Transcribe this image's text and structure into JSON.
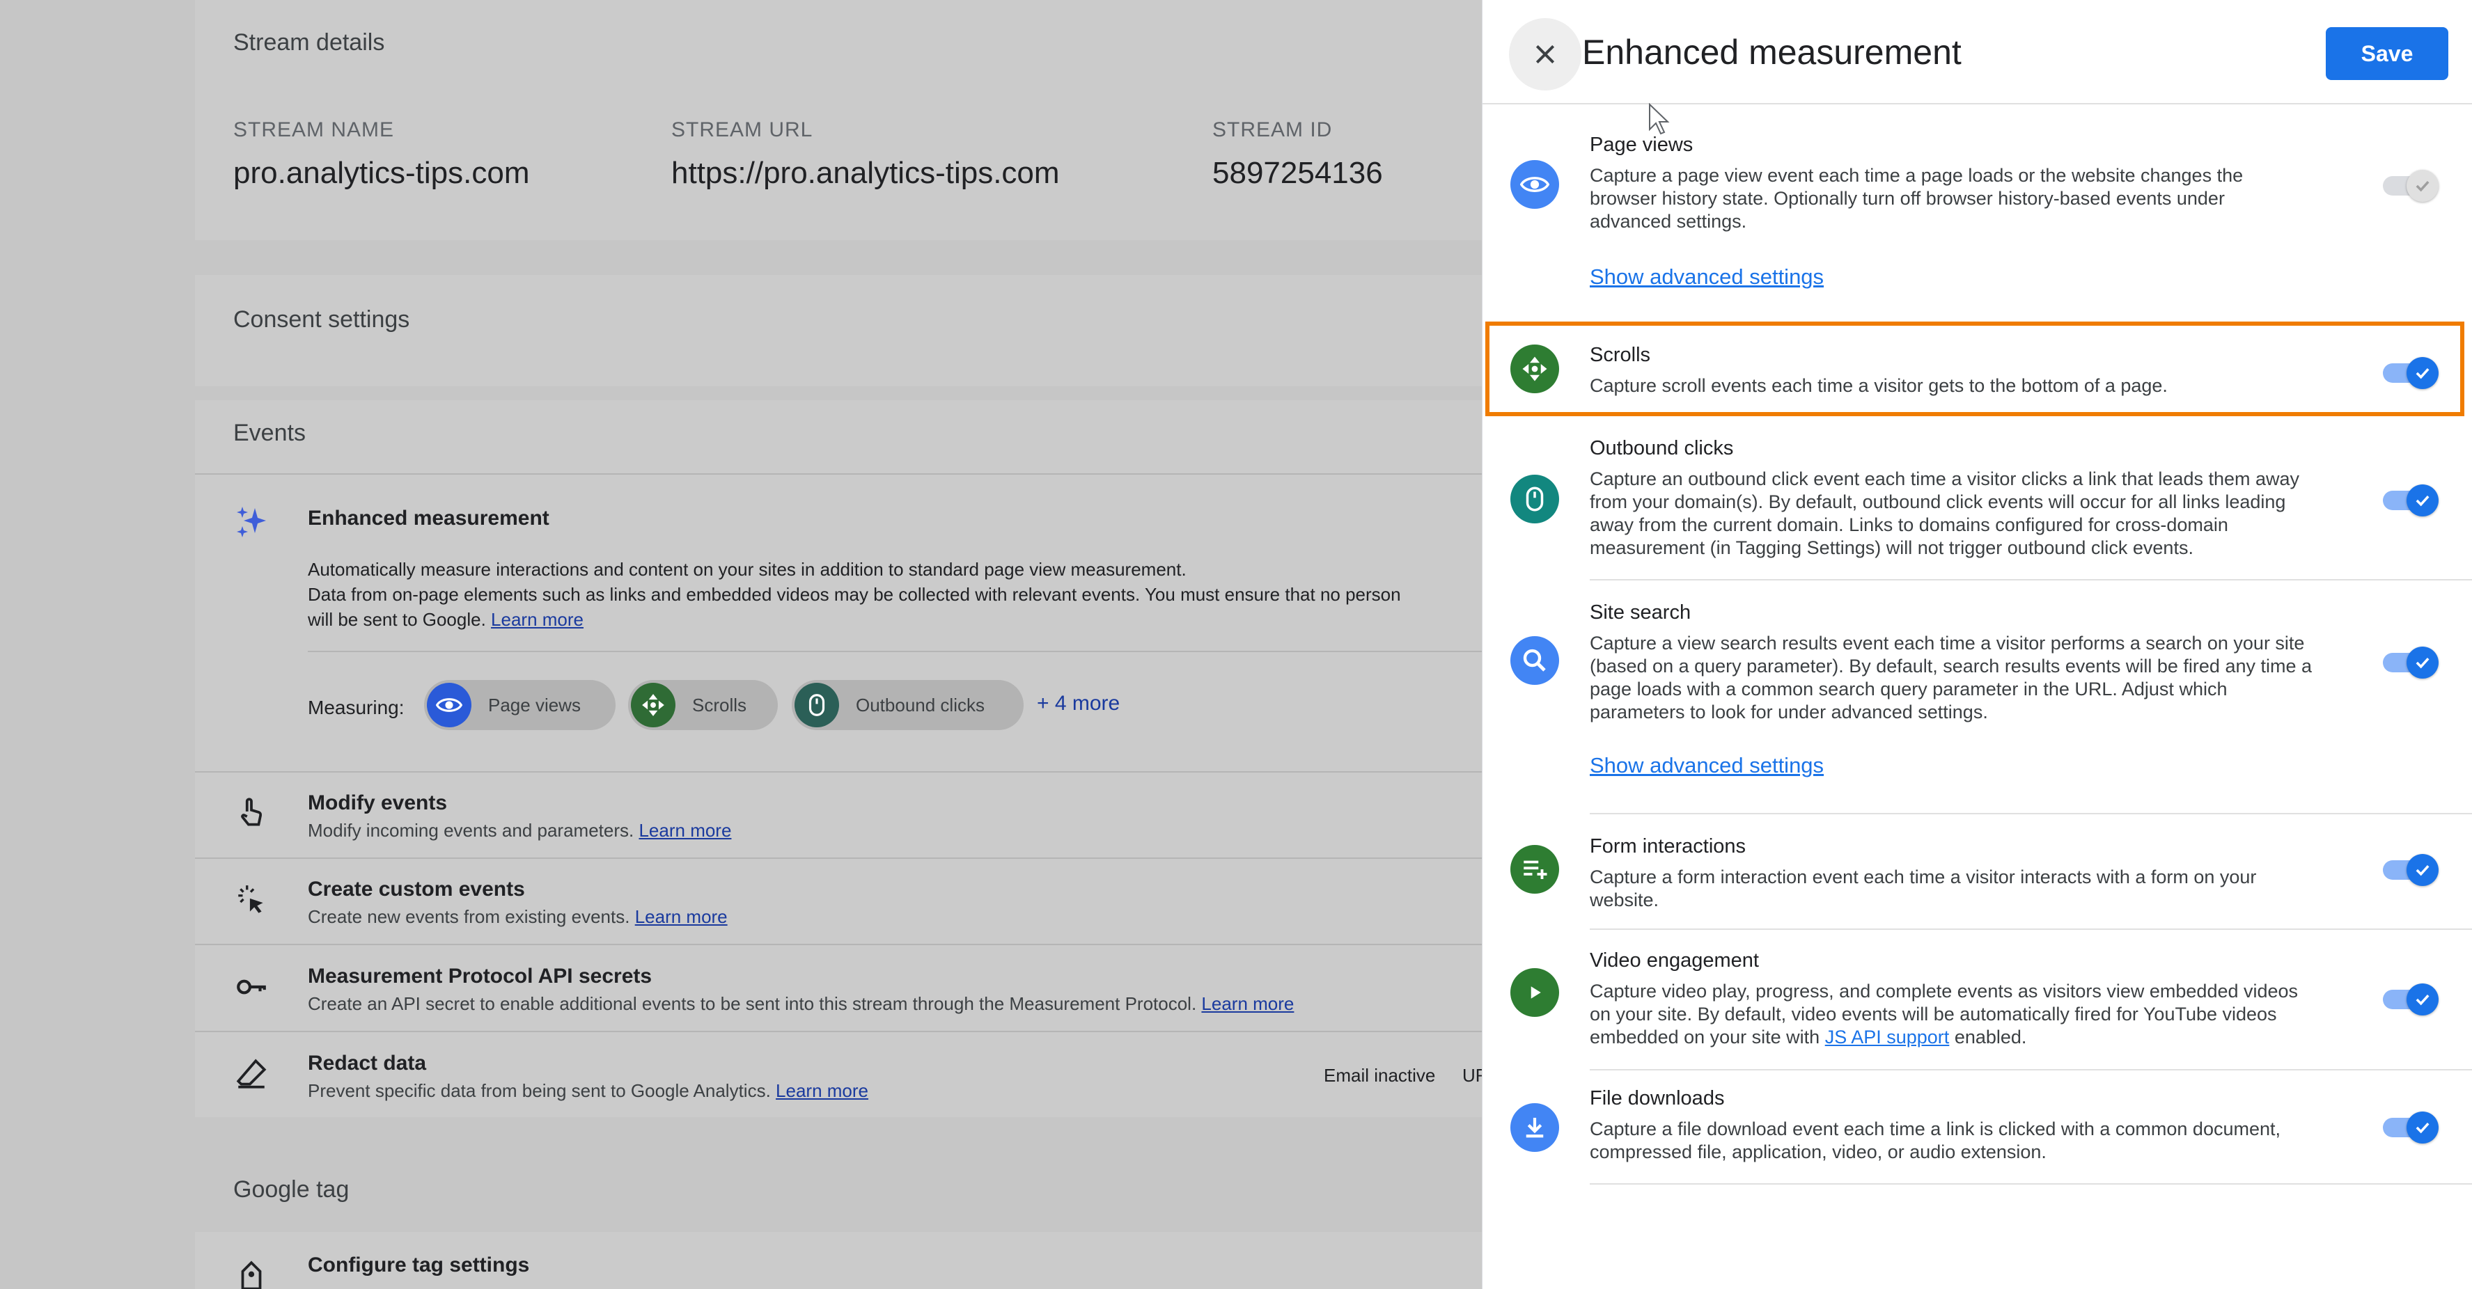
{
  "background": {
    "stream_details": {
      "title": "Stream details",
      "name_label": "STREAM NAME",
      "name_value": "pro.analytics-tips.com",
      "url_label": "STREAM URL",
      "url_value": "https://pro.analytics-tips.com",
      "id_label": "STREAM ID",
      "id_value": "5897254136"
    },
    "consent_title": "Consent settings",
    "events_title": "Events",
    "enhanced": {
      "title": "Enhanced measurement",
      "desc_line1": "Automatically measure interactions and content on your sites in addition to standard page view measurement.",
      "desc_line2": "Data from on-page elements such as links and embedded videos may be collected with relevant events. You must ensure that no person",
      "desc_line3": "will be sent to Google.",
      "learn_more": "Learn more",
      "measuring_label": "Measuring:",
      "chips": [
        "Page views",
        "Scrolls",
        "Outbound clicks"
      ],
      "more": "+ 4 more"
    },
    "rows": [
      {
        "title": "Modify events",
        "desc": "Modify incoming events and parameters.",
        "link": "Learn more"
      },
      {
        "title": "Create custom events",
        "desc": "Create new events from existing events.",
        "link": "Learn more"
      },
      {
        "title": "Measurement Protocol API secrets",
        "desc": "Create an API secret to enable additional events to be sent into this stream through the Measurement Protocol.",
        "link": "Learn more"
      },
      {
        "title": "Redact data",
        "desc": "Prevent specific data from being sent to Google Analytics.",
        "link": "Learn more"
      }
    ],
    "redact_status": "Email inactive",
    "redact_status2": "UR",
    "google_tag_title": "Google tag",
    "configure_tag": "Configure tag settings"
  },
  "drawer": {
    "title": "Enhanced measurement",
    "save_label": "Save",
    "advanced_label": "Show advanced settings",
    "items": [
      {
        "title": "Page views",
        "icon": "eye-icon",
        "color": "#4285f4",
        "enabled": true,
        "disabled": true,
        "lines": [
          "Capture a page view event each time a page loads or the website changes the",
          "browser history state. Optionally turn off browser history-based events under",
          "advanced settings."
        ]
      },
      {
        "title": "Scrolls",
        "icon": "scroll-arrows-icon",
        "color": "#34a853",
        "enabled": true,
        "highlighted": true,
        "lines": [
          "Capture scroll events each time a visitor gets to the bottom of a page."
        ]
      },
      {
        "title": "Outbound clicks",
        "icon": "mouse-icon",
        "color": "#12877f",
        "enabled": true,
        "lines": [
          "Capture an outbound click event each time a visitor clicks a link that leads them away",
          "from your domain(s). By default, outbound click events will occur for all links leading",
          "away from the current domain. Links to domains configured for cross-domain",
          "measurement (in Tagging Settings) will not trigger outbound click events."
        ]
      },
      {
        "title": "Site search",
        "icon": "search-icon",
        "color": "#4285f4",
        "enabled": true,
        "lines": [
          "Capture a view search results event each time a visitor performs a search on your site",
          "(based on a query parameter). By default, search results events will be fired any time a",
          "page loads with a common search query parameter in the URL. Adjust which",
          "parameters to look for under advanced settings."
        ]
      },
      {
        "title": "Form interactions",
        "icon": "form-list-icon",
        "color": "#34a853",
        "enabled": true,
        "lines": [
          "Capture a form interaction event each time a visitor interacts with a form on your",
          "website."
        ]
      },
      {
        "title": "Video engagement",
        "icon": "play-icon",
        "color": "#34a853",
        "enabled": true,
        "lines": [
          "Capture video play, progress, and complete events as visitors view embedded videos",
          "on your site. By default, video events will be automatically fired for YouTube videos"
        ],
        "last_line_pre": "embedded on your site with ",
        "last_line_link": "JS API support",
        "last_line_post": " enabled."
      },
      {
        "title": "File downloads",
        "icon": "download-icon",
        "color": "#4285f4",
        "enabled": true,
        "lines": [
          "Capture a file download event each time a link is clicked with a common document,",
          "compressed file, application, video, or audio extension."
        ]
      }
    ]
  }
}
